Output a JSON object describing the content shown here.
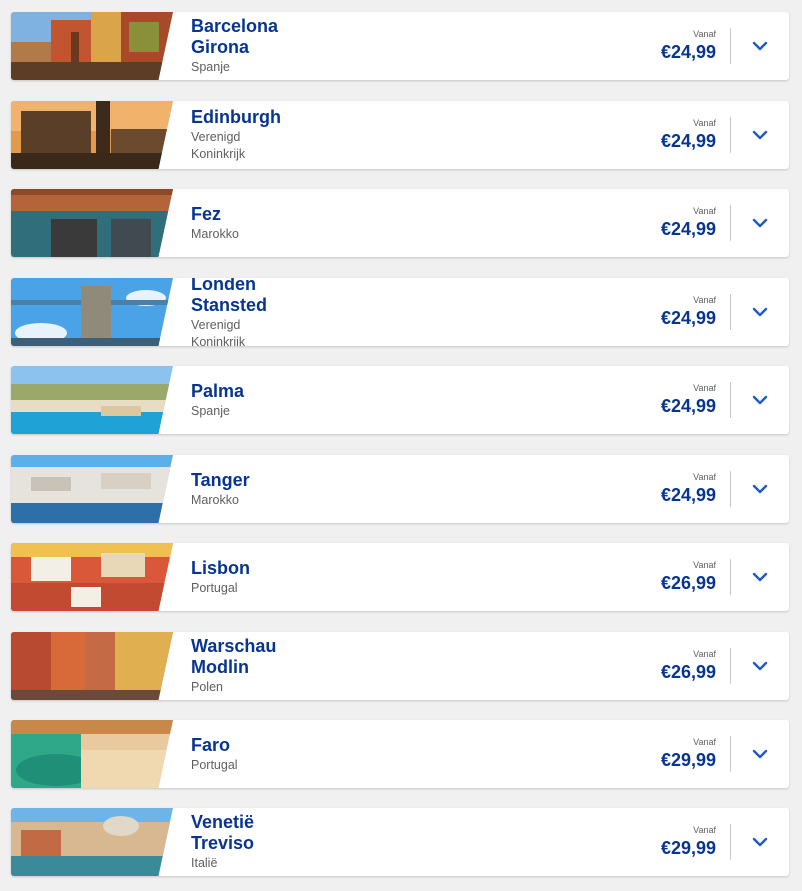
{
  "destinations": [
    {
      "cities": [
        "Barcelona",
        "Girona"
      ],
      "country": [
        "Spanje"
      ],
      "from_label": "Vanaf",
      "price": "€24,99"
    },
    {
      "cities": [
        "Edinburgh"
      ],
      "country": [
        "Verenigd",
        "Koninkrijk"
      ],
      "from_label": "Vanaf",
      "price": "€24,99"
    },
    {
      "cities": [
        "Fez"
      ],
      "country": [
        "Marokko"
      ],
      "from_label": "Vanaf",
      "price": "€24,99"
    },
    {
      "cities": [
        "Londen",
        "Stansted"
      ],
      "country": [
        "Verenigd",
        "Koninkrijk"
      ],
      "from_label": "Vanaf",
      "price": "€24,99"
    },
    {
      "cities": [
        "Palma"
      ],
      "country": [
        "Spanje"
      ],
      "from_label": "Vanaf",
      "price": "€24,99"
    },
    {
      "cities": [
        "Tanger"
      ],
      "country": [
        "Marokko"
      ],
      "from_label": "Vanaf",
      "price": "€24,99"
    },
    {
      "cities": [
        "Lisbon"
      ],
      "country": [
        "Portugal"
      ],
      "from_label": "Vanaf",
      "price": "€26,99"
    },
    {
      "cities": [
        "Warschau",
        "Modlin"
      ],
      "country": [
        "Polen"
      ],
      "from_label": "Vanaf",
      "price": "€26,99"
    },
    {
      "cities": [
        "Faro"
      ],
      "country": [
        "Portugal"
      ],
      "from_label": "Vanaf",
      "price": "€29,99"
    },
    {
      "cities": [
        "Venetië",
        "Treviso"
      ],
      "country": [
        "Italië"
      ],
      "from_label": "Vanaf",
      "price": "€29,99"
    }
  ],
  "colors": {
    "brand": "#073590",
    "accent": "#1e5bc6",
    "muted": "#5f5f5f"
  },
  "icons": {
    "expand": "chevron-down-icon"
  }
}
